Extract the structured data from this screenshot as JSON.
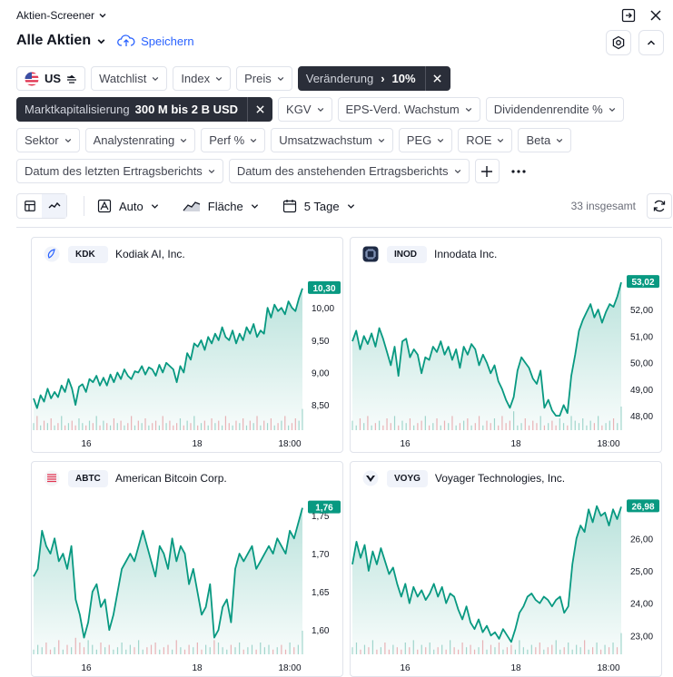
{
  "window": {
    "title": "Aktien-Screener"
  },
  "header": {
    "screener_name": "Alle Aktien",
    "save_label": "Speichern"
  },
  "filters": {
    "market": "US",
    "watchlist": "Watchlist",
    "index": "Index",
    "price": "Preis",
    "change_label": "Veränderung",
    "change_value": "10%",
    "mcap_label": "Marktkapitalisierung",
    "mcap_value": "300 M bis 2 B USD",
    "pe": "KGV",
    "eps_growth": "EPS-Verd. Wachstum",
    "dividend_yield": "Dividendenrendite %",
    "sector": "Sektor",
    "analyst_rating": "Analystenrating",
    "perf": "Perf %",
    "revenue_growth": "Umsatzwachstum",
    "peg": "PEG",
    "roe": "ROE",
    "beta": "Beta",
    "last_earnings": "Datum des letzten Ertragsberichts",
    "next_earnings": "Datum des anstehenden Ertragsberichts"
  },
  "toolbar": {
    "scale": "Auto",
    "chart_style": "Fläche",
    "period": "5 Tage",
    "total": "33 insgesamt"
  },
  "colors": {
    "accent": "#089981",
    "link": "#2962ff",
    "dark_chip": "#2a2e39"
  },
  "chart_data": [
    {
      "type": "area",
      "ticker": "KDK",
      "name": "Kodiak AI, Inc.",
      "last": "10,30",
      "last_value": 10.3,
      "x_ticks": [
        "16",
        "18",
        "18:00"
      ],
      "y_ticks": [
        "10,00",
        "9,50",
        "9,00",
        "8,50"
      ],
      "ylim": [
        8.25,
        10.55
      ],
      "values": [
        8.6,
        8.45,
        8.65,
        8.55,
        8.75,
        8.6,
        8.7,
        8.62,
        8.8,
        8.7,
        8.9,
        8.75,
        8.5,
        8.78,
        8.82,
        8.7,
        8.9,
        8.85,
        8.95,
        8.8,
        8.92,
        8.8,
        8.97,
        8.85,
        9.0,
        8.9,
        9.05,
        8.95,
        8.9,
        9.02,
        9.0,
        9.1,
        8.97,
        9.08,
        9.05,
        8.95,
        9.12,
        9.0,
        9.15,
        9.1,
        9.05,
        8.85,
        9.1,
        9.0,
        9.3,
        9.2,
        9.45,
        9.4,
        9.5,
        9.35,
        9.55,
        9.45,
        9.6,
        9.5,
        9.7,
        9.55,
        9.5,
        9.65,
        9.45,
        9.6,
        9.5,
        9.7,
        9.6,
        9.75,
        9.55,
        9.65,
        9.6,
        10.0,
        9.85,
        10.05,
        9.95,
        10.0,
        9.9,
        10.1,
        10.0,
        9.95,
        10.15,
        10.3
      ],
      "volume": [
        0.3,
        0.6,
        0.2,
        0.4,
        0.3,
        0.5,
        0.2,
        0.3,
        0.6,
        0.2,
        0.3,
        0.4,
        0.2,
        0.5,
        0.3,
        0.2,
        0.4,
        0.3,
        0.6,
        0.2,
        0.4,
        0.3,
        0.2,
        0.5,
        0.3,
        0.4,
        0.2,
        0.3,
        0.6,
        0.2,
        0.4,
        0.3,
        0.5,
        0.2,
        0.3,
        0.4,
        0.2,
        0.6,
        0.3,
        0.4,
        0.2,
        0.3,
        0.5,
        0.2,
        0.4,
        0.3,
        0.6,
        0.2,
        0.3,
        0.4,
        0.2,
        0.5,
        0.3,
        0.4,
        0.2,
        0.6,
        0.3,
        0.2,
        0.4,
        0.3,
        0.5,
        0.2,
        0.4,
        0.3,
        0.6,
        0.2,
        0.4,
        0.3,
        0.5,
        0.2,
        0.3,
        0.4,
        0.6,
        0.2,
        0.3,
        0.5,
        0.4,
        0.9
      ]
    },
    {
      "type": "area",
      "ticker": "INOD",
      "name": "Innodata Inc.",
      "last": "53,02",
      "last_value": 53.02,
      "x_ticks": [
        "16",
        "18",
        "18:00"
      ],
      "y_ticks": [
        "52,00",
        "51,00",
        "50,00",
        "49,00",
        "48,00"
      ],
      "ylim": [
        47.8,
        53.4
      ],
      "values": [
        50.8,
        51.2,
        50.5,
        51.0,
        50.7,
        51.1,
        50.6,
        51.3,
        50.9,
        50.4,
        49.9,
        50.6,
        49.5,
        50.8,
        50.9,
        50.2,
        50.5,
        50.3,
        49.6,
        50.2,
        50.1,
        50.6,
        50.4,
        50.8,
        50.3,
        50.6,
        50.1,
        50.5,
        49.8,
        50.6,
        50.3,
        50.7,
        50.5,
        49.9,
        50.3,
        50.0,
        49.6,
        49.9,
        49.3,
        49.0,
        48.6,
        48.3,
        48.7,
        49.7,
        50.2,
        50.0,
        49.8,
        49.4,
        49.2,
        49.7,
        48.3,
        48.6,
        48.2,
        48.0,
        48.0,
        48.4,
        48.1,
        49.5,
        50.3,
        51.2,
        51.6,
        51.9,
        52.2,
        51.7,
        52.0,
        51.5,
        51.9,
        52.2,
        52.1,
        52.5,
        53.02
      ],
      "volume": [
        0.4,
        0.2,
        0.5,
        0.3,
        0.6,
        0.2,
        0.3,
        0.4,
        0.2,
        0.5,
        0.3,
        0.6,
        0.2,
        0.4,
        0.3,
        0.5,
        0.2,
        0.3,
        0.4,
        0.6,
        0.2,
        0.3,
        0.5,
        0.2,
        0.4,
        0.3,
        0.6,
        0.2,
        0.3,
        0.4,
        0.5,
        0.2,
        0.3,
        0.6,
        0.2,
        0.4,
        0.3,
        0.5,
        0.2,
        0.6,
        0.3,
        0.4,
        0.8,
        0.2,
        0.3,
        0.5,
        0.2,
        0.4,
        0.3,
        0.6,
        0.2,
        0.3,
        0.4,
        0.2,
        0.5,
        0.3,
        0.2,
        0.6,
        0.4,
        0.3,
        0.5,
        0.2,
        0.4,
        0.3,
        0.6,
        0.2,
        0.3,
        0.4,
        0.5,
        0.3,
        1.0
      ]
    },
    {
      "type": "area",
      "ticker": "ABTC",
      "name": "American Bitcoin Corp.",
      "last": "1,76",
      "last_value": 1.76,
      "x_ticks": [
        "16",
        "18",
        "18:00"
      ],
      "y_ticks": [
        "1,75",
        "1,70",
        "1,65",
        "1,60"
      ],
      "ylim": [
        1.58,
        1.775
      ],
      "values": [
        1.67,
        1.68,
        1.73,
        1.71,
        1.7,
        1.72,
        1.69,
        1.7,
        1.68,
        1.71,
        1.64,
        1.62,
        1.59,
        1.61,
        1.65,
        1.66,
        1.63,
        1.64,
        1.6,
        1.62,
        1.65,
        1.68,
        1.69,
        1.7,
        1.69,
        1.71,
        1.73,
        1.71,
        1.69,
        1.67,
        1.71,
        1.7,
        1.68,
        1.72,
        1.69,
        1.71,
        1.7,
        1.66,
        1.68,
        1.65,
        1.62,
        1.63,
        1.66,
        1.59,
        1.6,
        1.63,
        1.64,
        1.61,
        1.68,
        1.7,
        1.69,
        1.7,
        1.71,
        1.68,
        1.69,
        1.7,
        1.71,
        1.7,
        1.72,
        1.71,
        1.7,
        1.73,
        1.72,
        1.74,
        1.76
      ],
      "volume": [
        0.2,
        0.4,
        0.3,
        0.5,
        0.2,
        0.3,
        0.6,
        0.2,
        0.4,
        0.3,
        0.7,
        0.5,
        0.3,
        0.6,
        0.4,
        0.2,
        0.5,
        0.3,
        0.4,
        0.2,
        0.3,
        0.5,
        0.2,
        0.4,
        0.3,
        0.6,
        0.2,
        0.3,
        0.4,
        0.5,
        0.2,
        0.3,
        0.4,
        0.2,
        0.6,
        0.3,
        0.2,
        0.4,
        0.3,
        0.5,
        0.2,
        0.4,
        0.3,
        0.6,
        0.5,
        0.3,
        0.2,
        0.4,
        0.3,
        0.5,
        0.2,
        0.3,
        0.4,
        0.2,
        0.5,
        0.3,
        0.4,
        0.2,
        0.3,
        0.4,
        0.2,
        0.5,
        0.3,
        0.4,
        1.0
      ]
    },
    {
      "type": "area",
      "ticker": "VOYG",
      "name": "Voyager Technologies, Inc.",
      "last": "26,98",
      "last_value": 26.98,
      "x_ticks": [
        "16",
        "18",
        "18:00"
      ],
      "y_ticks": [
        "26,00",
        "25,00",
        "24,00",
        "23,00"
      ],
      "ylim": [
        22.7,
        27.3
      ],
      "values": [
        25.2,
        25.9,
        25.4,
        25.8,
        25.0,
        25.6,
        25.2,
        25.7,
        25.3,
        24.9,
        25.1,
        24.6,
        24.2,
        24.6,
        24.0,
        24.5,
        24.2,
        24.4,
        24.1,
        24.3,
        24.6,
        24.2,
        24.5,
        24.0,
        24.3,
        24.2,
        23.8,
        23.5,
        23.9,
        23.4,
        23.2,
        23.5,
        23.1,
        23.3,
        23.0,
        23.1,
        22.9,
        23.2,
        23.0,
        22.8,
        23.2,
        23.7,
        23.9,
        24.2,
        24.3,
        24.1,
        24.0,
        24.2,
        24.1,
        23.9,
        24.1,
        24.2,
        23.7,
        23.9,
        25.2,
        26.0,
        26.4,
        26.2,
        26.9,
        26.5,
        27.0,
        26.7,
        26.8,
        26.4,
        26.9,
        26.6,
        26.98
      ],
      "volume": [
        0.3,
        0.5,
        0.2,
        0.4,
        0.3,
        0.6,
        0.2,
        0.3,
        0.5,
        0.2,
        0.4,
        0.3,
        0.2,
        0.5,
        0.3,
        0.6,
        0.2,
        0.4,
        0.3,
        0.5,
        0.2,
        0.3,
        0.4,
        0.2,
        0.6,
        0.3,
        0.2,
        0.5,
        0.3,
        0.4,
        0.2,
        0.3,
        0.6,
        0.2,
        0.4,
        0.3,
        0.5,
        0.2,
        0.3,
        0.4,
        0.2,
        0.6,
        0.3,
        0.2,
        0.4,
        0.3,
        0.5,
        0.2,
        0.3,
        0.4,
        0.6,
        0.2,
        0.3,
        0.5,
        0.2,
        0.4,
        0.3,
        0.6,
        0.2,
        0.3,
        0.5,
        0.2,
        0.4,
        0.3,
        0.5,
        0.3,
        0.9
      ]
    }
  ]
}
